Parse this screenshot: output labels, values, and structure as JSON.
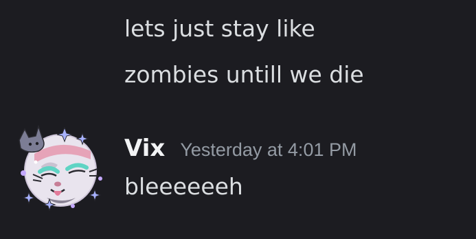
{
  "messages": {
    "continued": [
      "lets just stay like",
      "zombies untill we die"
    ],
    "group": {
      "author": "Vix",
      "timestamp": "Yesterday at 4:01 PM",
      "text": "bleeeeeeh",
      "avatar_icon": "avatar-decorated-character"
    }
  },
  "colors": {
    "background": "#1c1c21",
    "message_text": "#dbdee1",
    "author_name": "#f2f3f5",
    "timestamp": "#949ba4"
  }
}
